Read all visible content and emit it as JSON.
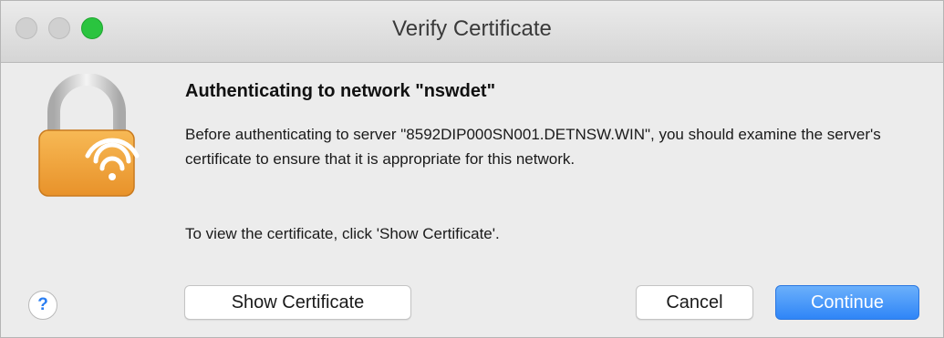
{
  "window": {
    "title": "Verify Certificate"
  },
  "dialog": {
    "heading": "Authenticating to network \"nswdet\"",
    "body": "Before authenticating to server \"8592DIP000SN001.DETNSW.WIN\", you should examine the server's certificate to ensure that it is appropriate for this network.",
    "hint": "To view the certificate, click 'Show Certificate'."
  },
  "buttons": {
    "help_label": "?",
    "show_certificate_label": "Show Certificate",
    "cancel_label": "Cancel",
    "continue_label": "Continue"
  },
  "icons": {
    "lock": "lock-wifi-icon",
    "help": "question-mark-icon"
  },
  "colors": {
    "accent": "#2f85f7",
    "zoom_button": "#2ac43f",
    "lock_body": "#f2a83a"
  }
}
